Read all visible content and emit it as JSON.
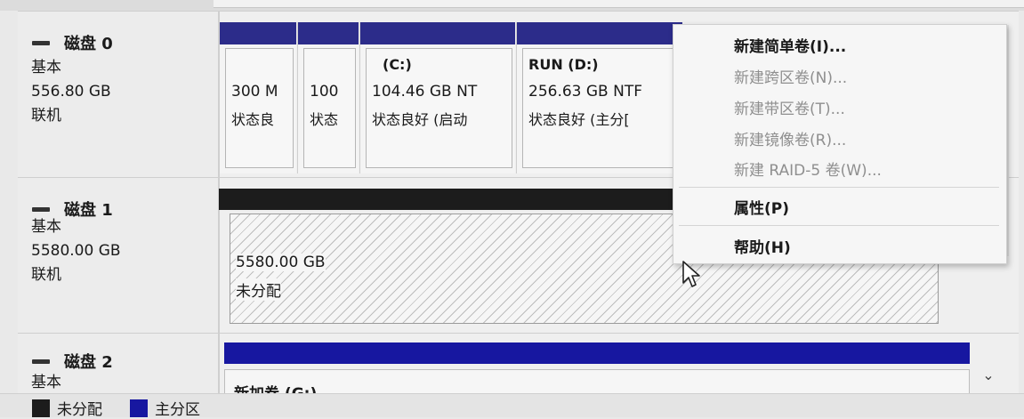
{
  "disks": [
    {
      "title": "磁盘 0",
      "type": "基本",
      "size": "556.80 GB",
      "status": "联机",
      "partitions": [
        {
          "name": "",
          "size": "300 M",
          "status": "状态良"
        },
        {
          "name": "",
          "size": "100",
          "status": "状态"
        },
        {
          "name": "(C:)",
          "size": "104.46 GB NT",
          "status": "状态良好 (启动"
        },
        {
          "name": "RUN  (D:)",
          "size": "256.63 GB NTF",
          "status": "状态良好 (主分["
        }
      ]
    },
    {
      "title": "磁盘 1",
      "type": "基本",
      "size": "5580.00 GB",
      "status": "联机",
      "unallocated": {
        "size": "5580.00 GB",
        "label": "未分配"
      }
    },
    {
      "title": "磁盘 2",
      "type": "基本",
      "volume": {
        "name": "新加卷  (G:)"
      }
    }
  ],
  "legend": [
    {
      "label": "未分配",
      "color": "#1c1c1c"
    },
    {
      "label": "主分区",
      "color": "#1717a0"
    }
  ],
  "context_menu": {
    "items": [
      {
        "label": "新建简单卷(I)...",
        "enabled": true
      },
      {
        "label": "新建跨区卷(N)...",
        "enabled": false
      },
      {
        "label": "新建带区卷(T)...",
        "enabled": false
      },
      {
        "label": "新建镜像卷(R)...",
        "enabled": false
      },
      {
        "label": "新建 RAID-5 卷(W)...",
        "enabled": false
      },
      {
        "label": "属性(P)",
        "enabled": true
      },
      {
        "label": "帮助(H)",
        "enabled": true
      }
    ]
  },
  "icons": {
    "disk": "dash-icon",
    "scroll": "chevron-down-icon",
    "cursor": "mouse-pointer-icon"
  },
  "colors": {
    "primary_partition": "#1717a0",
    "unallocated": "#1c1c1c"
  }
}
